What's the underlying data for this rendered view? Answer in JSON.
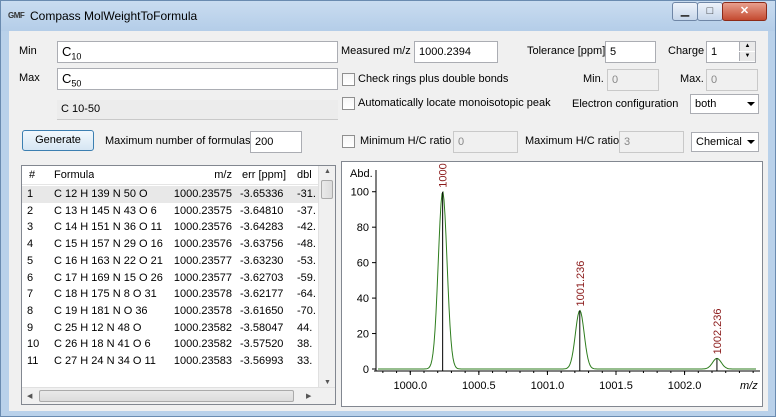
{
  "window": {
    "title": "Compass MolWeightToFormula",
    "icon_text": "GMF"
  },
  "left": {
    "min_label": "Min",
    "min_prefix": "C",
    "min_sub": "10",
    "max_label": "Max",
    "max_prefix": "C",
    "max_sub": "50",
    "range_text": "C 10-50",
    "generate_label": "Generate",
    "maxformulas_label": "Maximum number of formulas",
    "maxformulas_value": "200"
  },
  "right": {
    "mz_label": "Measured m/z",
    "mz_value": "1000.2394",
    "tol_label": "Tolerance [ppm]",
    "tol_value": "5",
    "charge_label": "Charge",
    "charge_value": "1",
    "rings_label": "Check rings plus double bonds",
    "min_label": "Min.",
    "min_value": "0",
    "max_label": "Max.",
    "max_value": "0",
    "mono_label": "Automatically locate monoisotopic peak",
    "electron_label": "Electron configuration",
    "electron_value": "both",
    "minhc_label": "Minimum H/C ratio",
    "minhc_value": "0",
    "maxhc_label": "Maximum H/C ratio",
    "maxhc_value": "3",
    "mode_value": "Chemical"
  },
  "table": {
    "headers": [
      "#",
      "Formula",
      "m/z",
      "err [ppm]",
      "dbl"
    ],
    "rows": [
      [
        "1",
        "C 12 H 139 N 50 O",
        "1000.23575",
        "-3.65336",
        "-31."
      ],
      [
        "2",
        "C 13 H 145 N 43 O 6",
        "1000.23575",
        "-3.64810",
        "-37."
      ],
      [
        "3",
        "C 14 H 151 N 36 O 11",
        "1000.23576",
        "-3.64283",
        "-42."
      ],
      [
        "4",
        "C 15 H 157 N 29 O 16",
        "1000.23576",
        "-3.63756",
        "-48."
      ],
      [
        "5",
        "C 16 H 163 N 22 O 21",
        "1000.23577",
        "-3.63230",
        "-53."
      ],
      [
        "6",
        "C 17 H 169 N 15 O 26",
        "1000.23577",
        "-3.62703",
        "-59."
      ],
      [
        "7",
        "C 18 H 175 N 8 O 31",
        "1000.23578",
        "-3.62177",
        "-64."
      ],
      [
        "8",
        "C 19 H 181 N O 36",
        "1000.23578",
        "-3.61650",
        "-70."
      ],
      [
        "9",
        "C 25 H 12 N 48 O",
        "1000.23582",
        "-3.58047",
        "44."
      ],
      [
        "10",
        "C 26 H 18 N 41 O 6",
        "1000.23582",
        "-3.57520",
        "38."
      ],
      [
        "11",
        "C 27 H 24 N 34 O 11",
        "1000.23583",
        "-3.56993",
        "33."
      ]
    ]
  },
  "chart_data": {
    "type": "line",
    "ylabel": "Abd.",
    "xlabel": "m/z",
    "xlim": [
      999.75,
      1002.55
    ],
    "ylim": [
      0,
      110
    ],
    "xticks": [
      "1000.0",
      "1000.5",
      "1001.0",
      "1001.5",
      "1002.0"
    ],
    "yticks": [
      "0",
      "20",
      "40",
      "60",
      "80",
      "100"
    ],
    "peaks": [
      {
        "x": 1000.236,
        "y": 100,
        "label": "1000"
      },
      {
        "x": 1001.236,
        "y": 33,
        "label": "1001.236"
      },
      {
        "x": 1002.236,
        "y": 6,
        "label": "1002.236"
      }
    ],
    "line_color": "#2e7d1e",
    "label_color": "#8b1a1a"
  }
}
